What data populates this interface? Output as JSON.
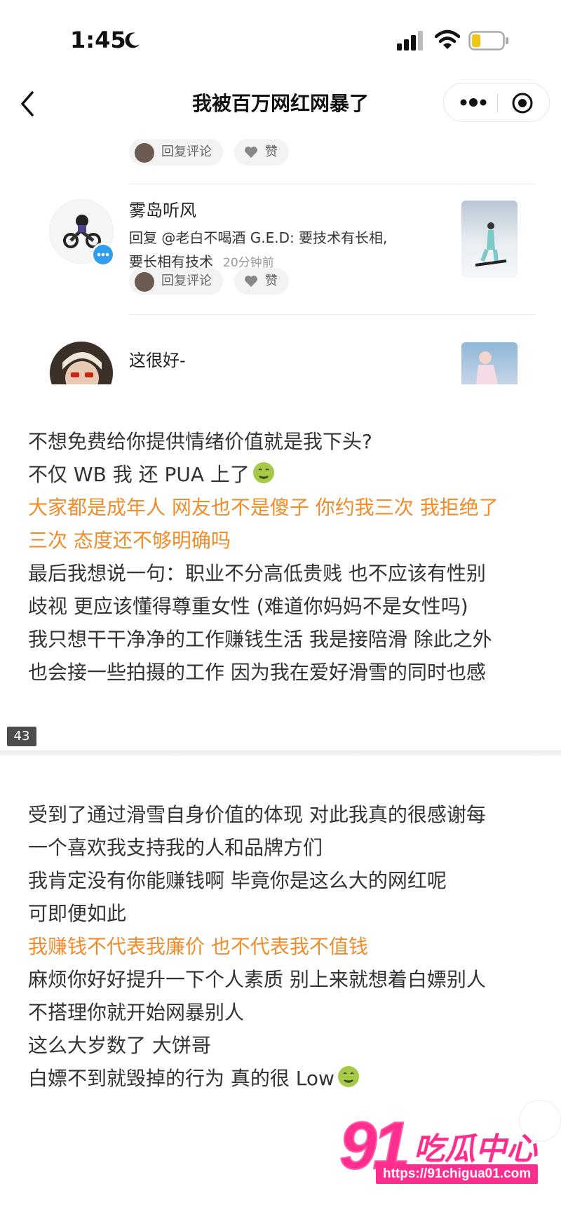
{
  "status_bar": {
    "time": "1:45",
    "icons": [
      "moon-icon",
      "signal-icon",
      "wifi-icon",
      "battery-icon"
    ]
  },
  "nav": {
    "title": "我被百万网红网暴了",
    "icons": [
      "back-icon",
      "more-icon",
      "close-mini-program-icon"
    ]
  },
  "comments": {
    "top_actions": {
      "reply_label": "回复评论",
      "like_label": "赞"
    },
    "items": [
      {
        "name": "雾岛听风",
        "text_line1": "回复 @老白不喝酒 G.E.D: 要技术有长相,",
        "text_line2": "要长相有技术",
        "time": "20分钟前",
        "reply_label": "回复评论",
        "like_label": "赞"
      },
      {
        "name": "这很好-"
      }
    ]
  },
  "article": {
    "lines_a": [
      {
        "text": "不想免费给你提供情绪价值就是我下头?",
        "highlight": false
      },
      {
        "text": "不仅 WB 我 还 PUA 上了",
        "highlight": false,
        "emoji": "nauseated-face-icon"
      },
      {
        "text": "大家都是成年人 网友也不是傻子 你约我三次 我拒绝了",
        "highlight": true
      },
      {
        "text": "三次 态度还不够明确吗",
        "highlight": true
      },
      {
        "text": "最后我想说一句：职业不分高低贵贱 也不应该有性别",
        "highlight": false
      },
      {
        "text": "歧视 更应该懂得尊重女性 (难道你妈妈不是女性吗)",
        "highlight": false
      },
      {
        "text": "我只想干干净净的工作赚钱生活 我是接陪滑 除此之外",
        "highlight": false
      },
      {
        "text": "也会接一些拍摄的工作 因为我在爱好滑雪的同时也感",
        "highlight": false
      }
    ],
    "page_number": "43",
    "lines_b": [
      {
        "text": "受到了通过滑雪自身价值的体现 对此我真的很感谢每",
        "highlight": false
      },
      {
        "text": "一个喜欢我支持我的人和品牌方们",
        "highlight": false
      },
      {
        "text": "我肯定没有你能赚钱啊 毕竟你是这么大的网红呢",
        "highlight": false
      },
      {
        "text": "可即便如此",
        "highlight": false
      },
      {
        "text": "我赚钱不代表我廉价 也不代表我不值钱",
        "highlight": true
      },
      {
        "text": "麻烦你好好提升一下个人素质 别上来就想着白嫖别人",
        "highlight": false
      },
      {
        "text": "不搭理你就开始网暴别人",
        "highlight": false
      },
      {
        "text": "这么大岁数了 大饼哥",
        "highlight": false
      },
      {
        "text": "白嫖不到就毁掉的行为 真的很 Low",
        "highlight": false,
        "emoji": "nauseated-face-icon"
      }
    ]
  },
  "watermark": {
    "number": "91",
    "name": "吃瓜中心",
    "url": "https://91chigua01.com"
  },
  "colors": {
    "highlight": "#f08d2a",
    "watermark": "#ff2d8e",
    "text": "#333333"
  }
}
